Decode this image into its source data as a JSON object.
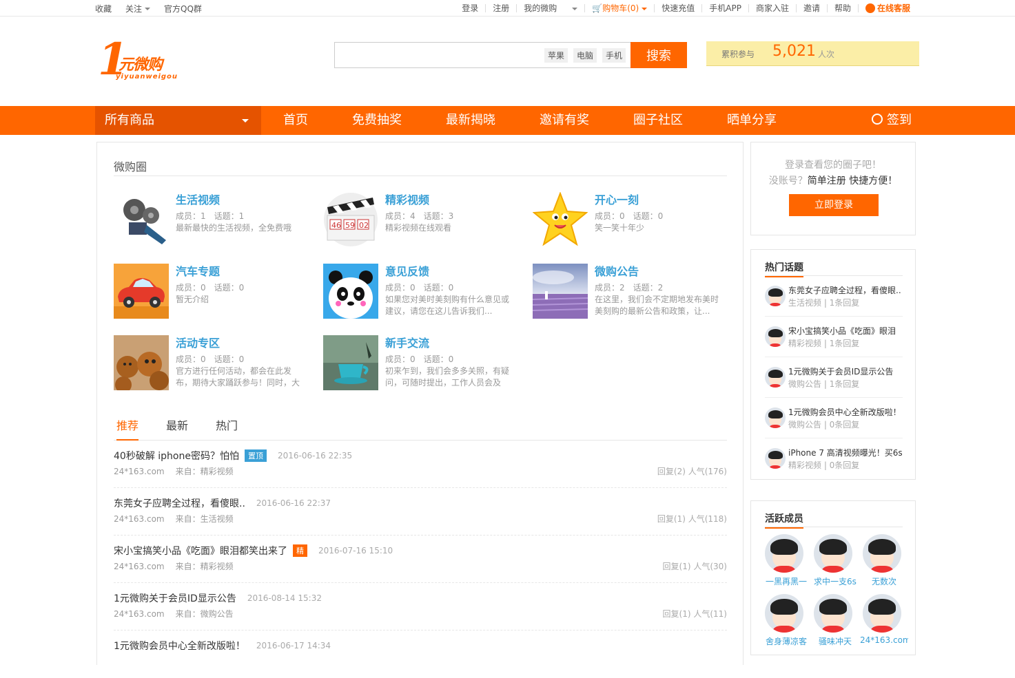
{
  "topbar": {
    "left": [
      {
        "label": "收藏"
      },
      {
        "label": "关注",
        "dropdown": true
      },
      {
        "label": "官方QQ群"
      }
    ],
    "right": [
      {
        "label": "登录"
      },
      {
        "label": "注册"
      },
      {
        "label": "我的微购"
      },
      {
        "label": "购物车(0)"
      },
      {
        "label": "快速充值"
      },
      {
        "label": "手机APP"
      },
      {
        "label": "商家入驻"
      },
      {
        "label": "邀请"
      },
      {
        "label": "帮助"
      },
      {
        "label": "在线客服"
      }
    ]
  },
  "logo": {
    "digit": "1",
    "cn": "元微购",
    "en": "yiyuanweigou"
  },
  "search": {
    "placeholder": "",
    "hot": [
      "苹果",
      "电脑",
      "手机"
    ],
    "button": "搜索"
  },
  "counter": {
    "label": "累积参与",
    "value": "5,021",
    "unit": "人次"
  },
  "nav": {
    "all": "所有商品",
    "items": [
      "首页",
      "免费抽奖",
      "最新揭晓",
      "邀请有奖",
      "圈子社区",
      "晒单分享"
    ],
    "sign": "签到"
  },
  "groups": {
    "title": "微购圈",
    "items": [
      {
        "name": "生活视频",
        "stats": "成员：1　话题：1",
        "desc": "最新最快的生活视频，全免费哦",
        "icon": "film-reel-icon"
      },
      {
        "name": "精彩视频",
        "stats": "成员：4　话题：3",
        "desc": "精彩视频在线观看",
        "icon": "clapperboard-icon"
      },
      {
        "name": "开心一刻",
        "stats": "成员：0　话题：0",
        "desc": "笑一笑十年少",
        "icon": "star-icon"
      },
      {
        "name": "汽车专题",
        "stats": "成员：0　话题：0",
        "desc": "暂无介绍",
        "icon": "car-icon"
      },
      {
        "name": "意见反馈",
        "stats": "成员：0　话题：0",
        "desc": "如果您对美时美刻购有什么意见或建议，请您在这儿告诉我们...",
        "icon": "panda-icon"
      },
      {
        "name": "微购公告",
        "stats": "成员：2　话题：2",
        "desc": "在这里，我们会不定期地发布美时美刻购的最新公告和政策，让...",
        "icon": "lavender-field-image"
      },
      {
        "name": "活动专区",
        "stats": "成员：0　话题：0",
        "desc": "官方进行任何活动，都会在此发布，期待大家踊跃参与！同时，大",
        "icon": "bears-image"
      },
      {
        "name": "新手交流",
        "stats": "成员：0　话题：0",
        "desc": "初来乍到，我们会多多关照，有疑问，可随时提出，工作人员会及",
        "icon": "teacup-image"
      }
    ]
  },
  "tabs": [
    "推荐",
    "最新",
    "热门"
  ],
  "posts": [
    {
      "title": "40秒破解 iphone密码？怕怕",
      "badge": "置顶",
      "badge_color": "#3aa0d6",
      "date": "2016-06-16 22:35",
      "user": "24*163.com",
      "from": "来自：精彩视频",
      "counts": "回复(2)  人气(176)"
    },
    {
      "title": "东莞女子应聘全过程，看傻眼..",
      "badge": "",
      "badge_color": "",
      "date": "2016-06-16 22:37",
      "user": "24*163.com",
      "from": "来自：生活视频",
      "counts": "回复(1)  人气(118)"
    },
    {
      "title": "宋小宝搞笑小品《吃面》眼泪都笑出来了",
      "badge": "精",
      "badge_color": "#f60",
      "date": "2016-07-16 15:10",
      "user": "24*163.com",
      "from": "来自：精彩视频",
      "counts": "回复(1)  人气(30)"
    },
    {
      "title": "1元微购关于会员ID显示公告",
      "badge": "",
      "badge_color": "",
      "date": "2016-08-14 15:32",
      "user": "24*163.com",
      "from": "来自：微购公告",
      "counts": "回复(1)  人气(11)"
    },
    {
      "title": "1元微购会员中心全新改版啦！",
      "badge": "",
      "badge_color": "",
      "date": "2016-06-17 14:34",
      "user": "",
      "from": "",
      "counts": ""
    }
  ],
  "login_box": {
    "line1": "登录查看您的圈子吧！",
    "line2_pre": "没账号？",
    "line2_link": "简单注册 快捷方便！",
    "button": "立即登录"
  },
  "hot_topics": {
    "title": "热门话题",
    "items": [
      {
        "title": "东莞女子应聘全过程，看傻眼..",
        "sub": "生活视频 | 1条回复"
      },
      {
        "title": "宋小宝搞笑小品《吃面》眼泪",
        "sub": "精彩视频 | 1条回复"
      },
      {
        "title": "1元微购关于会员ID显示公告",
        "sub": "微购公告 | 1条回复"
      },
      {
        "title": "1元微购会员中心全新改版啦！",
        "sub": "微购公告 | 0条回复"
      },
      {
        "title": "iPhone 7 高清视频曝光！买6s",
        "sub": "精彩视频 | 0条回复"
      }
    ]
  },
  "members": {
    "title": "活跃成员",
    "items": [
      {
        "name": "一黑再黑一"
      },
      {
        "name": "求中一支6s"
      },
      {
        "name": "无数次"
      },
      {
        "name": "舍身薄凉客"
      },
      {
        "name": "骚味冲天"
      },
      {
        "name": "24*163.com"
      }
    ]
  },
  "colors": {
    "accent": "#ff6600",
    "link": "#3aa0d6"
  }
}
